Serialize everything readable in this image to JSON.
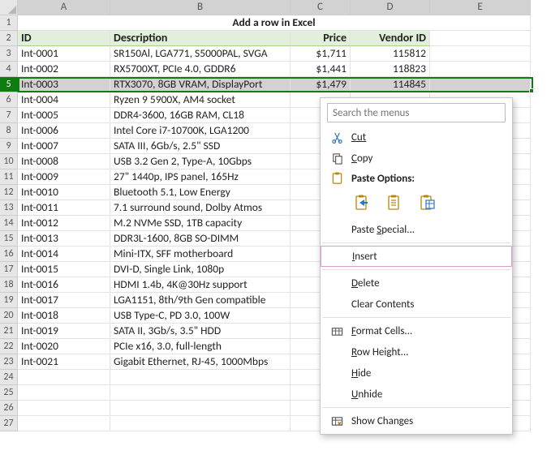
{
  "title": "Add a row in Excel",
  "columns": [
    "A",
    "B",
    "C",
    "D",
    "E"
  ],
  "col_widths": {
    "A": 114,
    "B": 222,
    "C": 74,
    "D": 98,
    "E": 124
  },
  "headers": {
    "A": "ID",
    "B": "Description",
    "C": "Price",
    "D": "Vendor ID"
  },
  "selected_row": 5,
  "data": [
    {
      "id": "Int-0001",
      "desc": "SR150Al, LGA771, S5000PAL, SVGA",
      "price": "$1,711",
      "vendor": "115812"
    },
    {
      "id": "Int-0002",
      "desc": "RX5700XT, PCIe 4.0, GDDR6",
      "price": "$1,441",
      "vendor": "118823"
    },
    {
      "id": "Int-0003",
      "desc": "RTX3070, 8GB VRAM, DisplayPort",
      "price": "$1,479",
      "vendor": "114845"
    },
    {
      "id": "Int-0004",
      "desc": "Ryzen 9 5900X, AM4 socket",
      "price": "",
      "vendor": ""
    },
    {
      "id": "Int-0005",
      "desc": "DDR4-3600, 16GB RAM, CL18",
      "price": "",
      "vendor": ""
    },
    {
      "id": "Int-0006",
      "desc": "Intel Core i7-10700K, LGA1200",
      "price": "",
      "vendor": ""
    },
    {
      "id": "Int-0007",
      "desc": "SATA III, 6Gb/s, 2.5\" SSD",
      "price": "",
      "vendor": ""
    },
    {
      "id": "Int-0008",
      "desc": "USB 3.2 Gen 2, Type-A, 10Gbps",
      "price": "",
      "vendor": ""
    },
    {
      "id": "Int-0009",
      "desc": "27\" 1440p, IPS panel, 165Hz",
      "price": "",
      "vendor": ""
    },
    {
      "id": "Int-0010",
      "desc": "Bluetooth 5.1, Low Energy",
      "price": "",
      "vendor": ""
    },
    {
      "id": "Int-0011",
      "desc": "7.1 surround sound, Dolby Atmos",
      "price": "",
      "vendor": ""
    },
    {
      "id": "Int-0012",
      "desc": "M.2 NVMe SSD, 1TB capacity",
      "price": "",
      "vendor": ""
    },
    {
      "id": "Int-0013",
      "desc": "DDR3L-1600, 8GB SO-DIMM",
      "price": "",
      "vendor": ""
    },
    {
      "id": "Int-0014",
      "desc": "Mini-ITX, SFF motherboard",
      "price": "",
      "vendor": ""
    },
    {
      "id": "Int-0015",
      "desc": "DVI-D, Single Link, 1080p",
      "price": "",
      "vendor": ""
    },
    {
      "id": "Int-0016",
      "desc": "HDMI 1.4b, 4K@30Hz support",
      "price": "",
      "vendor": ""
    },
    {
      "id": "Int-0017",
      "desc": "LGA1151, 8th/9th Gen compatible",
      "price": "",
      "vendor": ""
    },
    {
      "id": "Int-0018",
      "desc": "USB Type-C, PD 3.0, 100W",
      "price": "",
      "vendor": ""
    },
    {
      "id": "Int-0019",
      "desc": "SATA II, 3Gb/s, 3.5\" HDD",
      "price": "",
      "vendor": ""
    },
    {
      "id": "Int-0020",
      "desc": "PCIe x16, 3.0, full-length",
      "price": "",
      "vendor": ""
    },
    {
      "id": "Int-0021",
      "desc": "Gigabit Ethernet, RJ-45, 1000Mbps",
      "price": "",
      "vendor": ""
    }
  ],
  "blank_rows": [
    24,
    25,
    26,
    27
  ],
  "context_menu": {
    "search_placeholder": "Search the menus",
    "cut": "Cut",
    "copy": "Copy",
    "paste_options": "Paste Options:",
    "paste_special": "Paste Special...",
    "insert": "Insert",
    "delete": "Delete",
    "clear_contents": "Clear Contents",
    "format_cells": "Format Cells...",
    "row_height": "Row Height...",
    "hide": "Hide",
    "unhide": "Unhide",
    "show_changes": "Show Changes"
  }
}
